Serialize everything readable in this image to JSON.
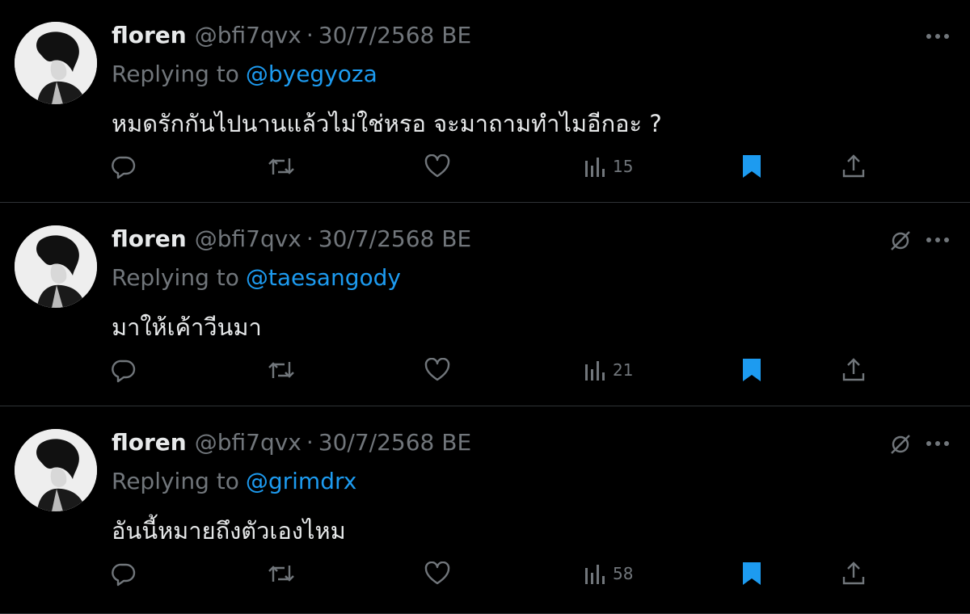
{
  "tweets": [
    {
      "name": "floren",
      "handle": "@bfi7qvx",
      "separator": "·",
      "date": "30/7/2568 BE",
      "replying_label": "Replying to",
      "mention": "@byegyoza",
      "text": "หมดรักกันไปนานแล้วไม่ใช่หรอ จะมาถามทำไมอีกอะ ?",
      "views": "15",
      "show_hide_icon": false,
      "bookmarked": true
    },
    {
      "name": "floren",
      "handle": "@bfi7qvx",
      "separator": "·",
      "date": "30/7/2568 BE",
      "replying_label": "Replying to",
      "mention": "@taesangody",
      "text": "มาให้เค้าวีนมา",
      "views": "21",
      "show_hide_icon": true,
      "bookmarked": true
    },
    {
      "name": "floren",
      "handle": "@bfi7qvx",
      "separator": "·",
      "date": "30/7/2568 BE",
      "replying_label": "Replying to",
      "mention": "@grimdrx",
      "text": "อันนี้หมายถึงตัวเองไหม",
      "views": "58",
      "show_hide_icon": true,
      "bookmarked": true
    }
  ],
  "icons": {
    "reply": "reply-icon",
    "retweet": "retweet-icon",
    "like": "like-icon",
    "views": "views-icon",
    "bookmark": "bookmark-icon",
    "share": "share-icon",
    "more": "more-icon",
    "hide": "hide-reply-icon"
  },
  "colors": {
    "background": "#000000",
    "text": "#e7e9ea",
    "muted": "#71767b",
    "accent": "#1d9bf0",
    "divider": "#2f3336"
  }
}
